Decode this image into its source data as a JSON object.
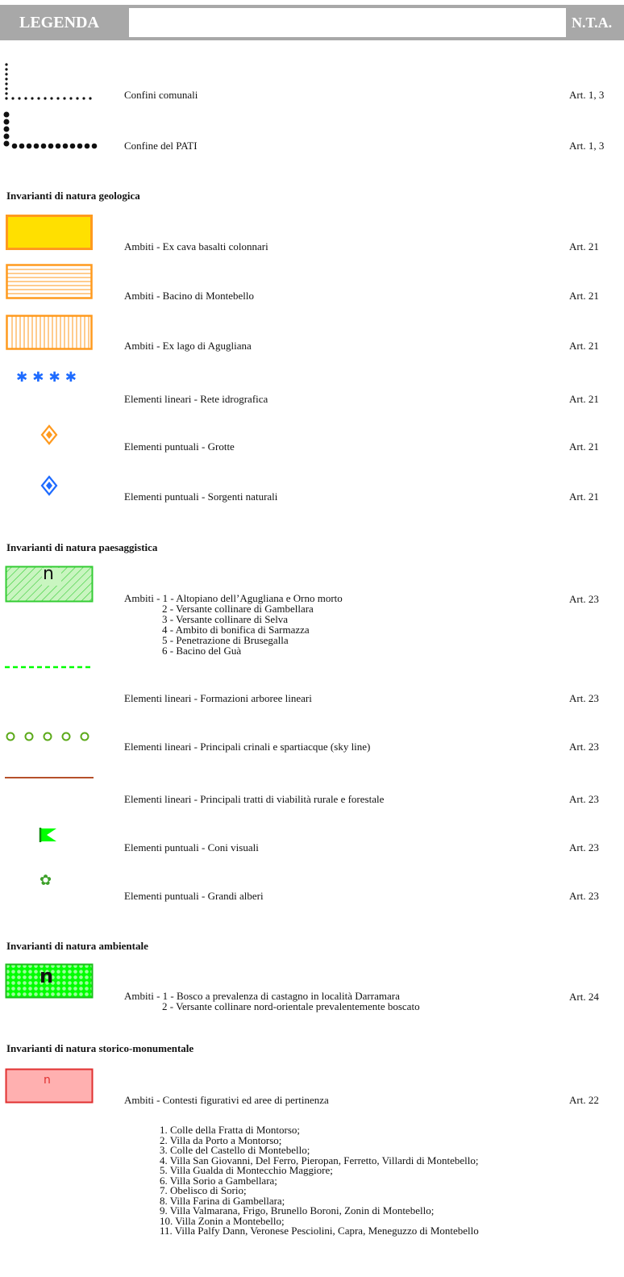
{
  "header": {
    "left": "LEGENDA",
    "right": "N.T.A."
  },
  "boundaries": [
    {
      "label": "Confini comunali",
      "art": "Art. 1, 3"
    },
    {
      "label": "Confine del PATI",
      "art": "Art. 1, 3"
    }
  ],
  "geologica": {
    "title": "Invarianti di natura geologica",
    "items": [
      {
        "label": "Ambiti - Ex cava basalti colonnari",
        "art": "Art. 21"
      },
      {
        "label": "Ambiti - Bacino di Montebello",
        "art": "Art. 21"
      },
      {
        "label": "Ambiti - Ex lago di Agugliana",
        "art": "Art. 21"
      },
      {
        "label": "Elementi lineari - Rete idrografica",
        "art": "Art. 21"
      },
      {
        "label": "Elementi puntuali - Grotte",
        "art": "Art. 21"
      },
      {
        "label": "Elementi puntuali - Sorgenti naturali",
        "art": "Art. 21"
      }
    ]
  },
  "paesaggistica": {
    "title": "Invarianti di natura paesaggistica",
    "ambiti": {
      "symbol_letter": "n",
      "lines": [
        "Ambiti - 1 - Altopiano dell’Agugliana e Orno morto",
        "2 - Versante collinare di Gambellara",
        "3 - Versante collinare di Selva",
        "4 - Ambito di bonifica di Sarmazza",
        "5 - Penetrazione di Brusegalla",
        "6 - Bacino del Guà"
      ],
      "art": "Art. 23"
    },
    "items": [
      {
        "label": "Elementi lineari - Formazioni arboree lineari",
        "art": "Art. 23"
      },
      {
        "label": "Elementi lineari - Principali crinali e spartiacque (sky line)",
        "art": "Art. 23"
      },
      {
        "label": "Elementi lineari - Principali tratti di viabilità rurale e forestale",
        "art": "Art. 23"
      },
      {
        "label": "Elementi puntuali - Coni visuali",
        "art": "Art. 23"
      },
      {
        "label": "Elementi puntuali - Grandi alberi",
        "art": "Art. 23"
      }
    ]
  },
  "ambientale": {
    "title": "Invarianti di natura ambientale",
    "symbol_letter": "n",
    "lines": [
      "Ambiti - 1 - Bosco a prevalenza di castagno in località Darramara",
      "2 - Versante collinare nord-orientale prevalentemente boscato"
    ],
    "art": "Art. 24"
  },
  "storico": {
    "title": "Invarianti di natura storico-monumentale",
    "symbol_letter": "n",
    "label": "Ambiti - Contesti figurativi ed aree di pertinenza",
    "art": "Art. 22",
    "list": [
      "1. Colle della Fratta di Montorso;",
      "2. Villa da Porto a Montorso;",
      "3. Colle del Castello di Montebello;",
      "4. Villa San Giovanni, Del Ferro, Pieropan, Ferretto, Villardi di Montebello;",
      "5. Villa Gualda di Montecchio Maggiore;",
      "6. Villa Sorio a Gambellara;",
      "7. Obelisco di Sorio;",
      "8. Villa Farina di Gambellara;",
      "9. Villa Valmarana, Frigo, Brunello Boroni, Zonin di Montebello;",
      "10. Villa Zonin a Montebello;",
      "11. Villa Palfy Dann, Veronese Pesciolini, Capra, Meneguzzo di Montebello"
    ]
  },
  "colors": {
    "header_gray": "#a8a8a8",
    "yellow_fill": "#ffe000",
    "orange": "#ff9a1e",
    "blue": "#1e6bff",
    "green": "#33cc33",
    "bright_green": "#00ff00",
    "brown": "#b5502a",
    "red": "#e03030",
    "pink": "#ffb0b0"
  }
}
